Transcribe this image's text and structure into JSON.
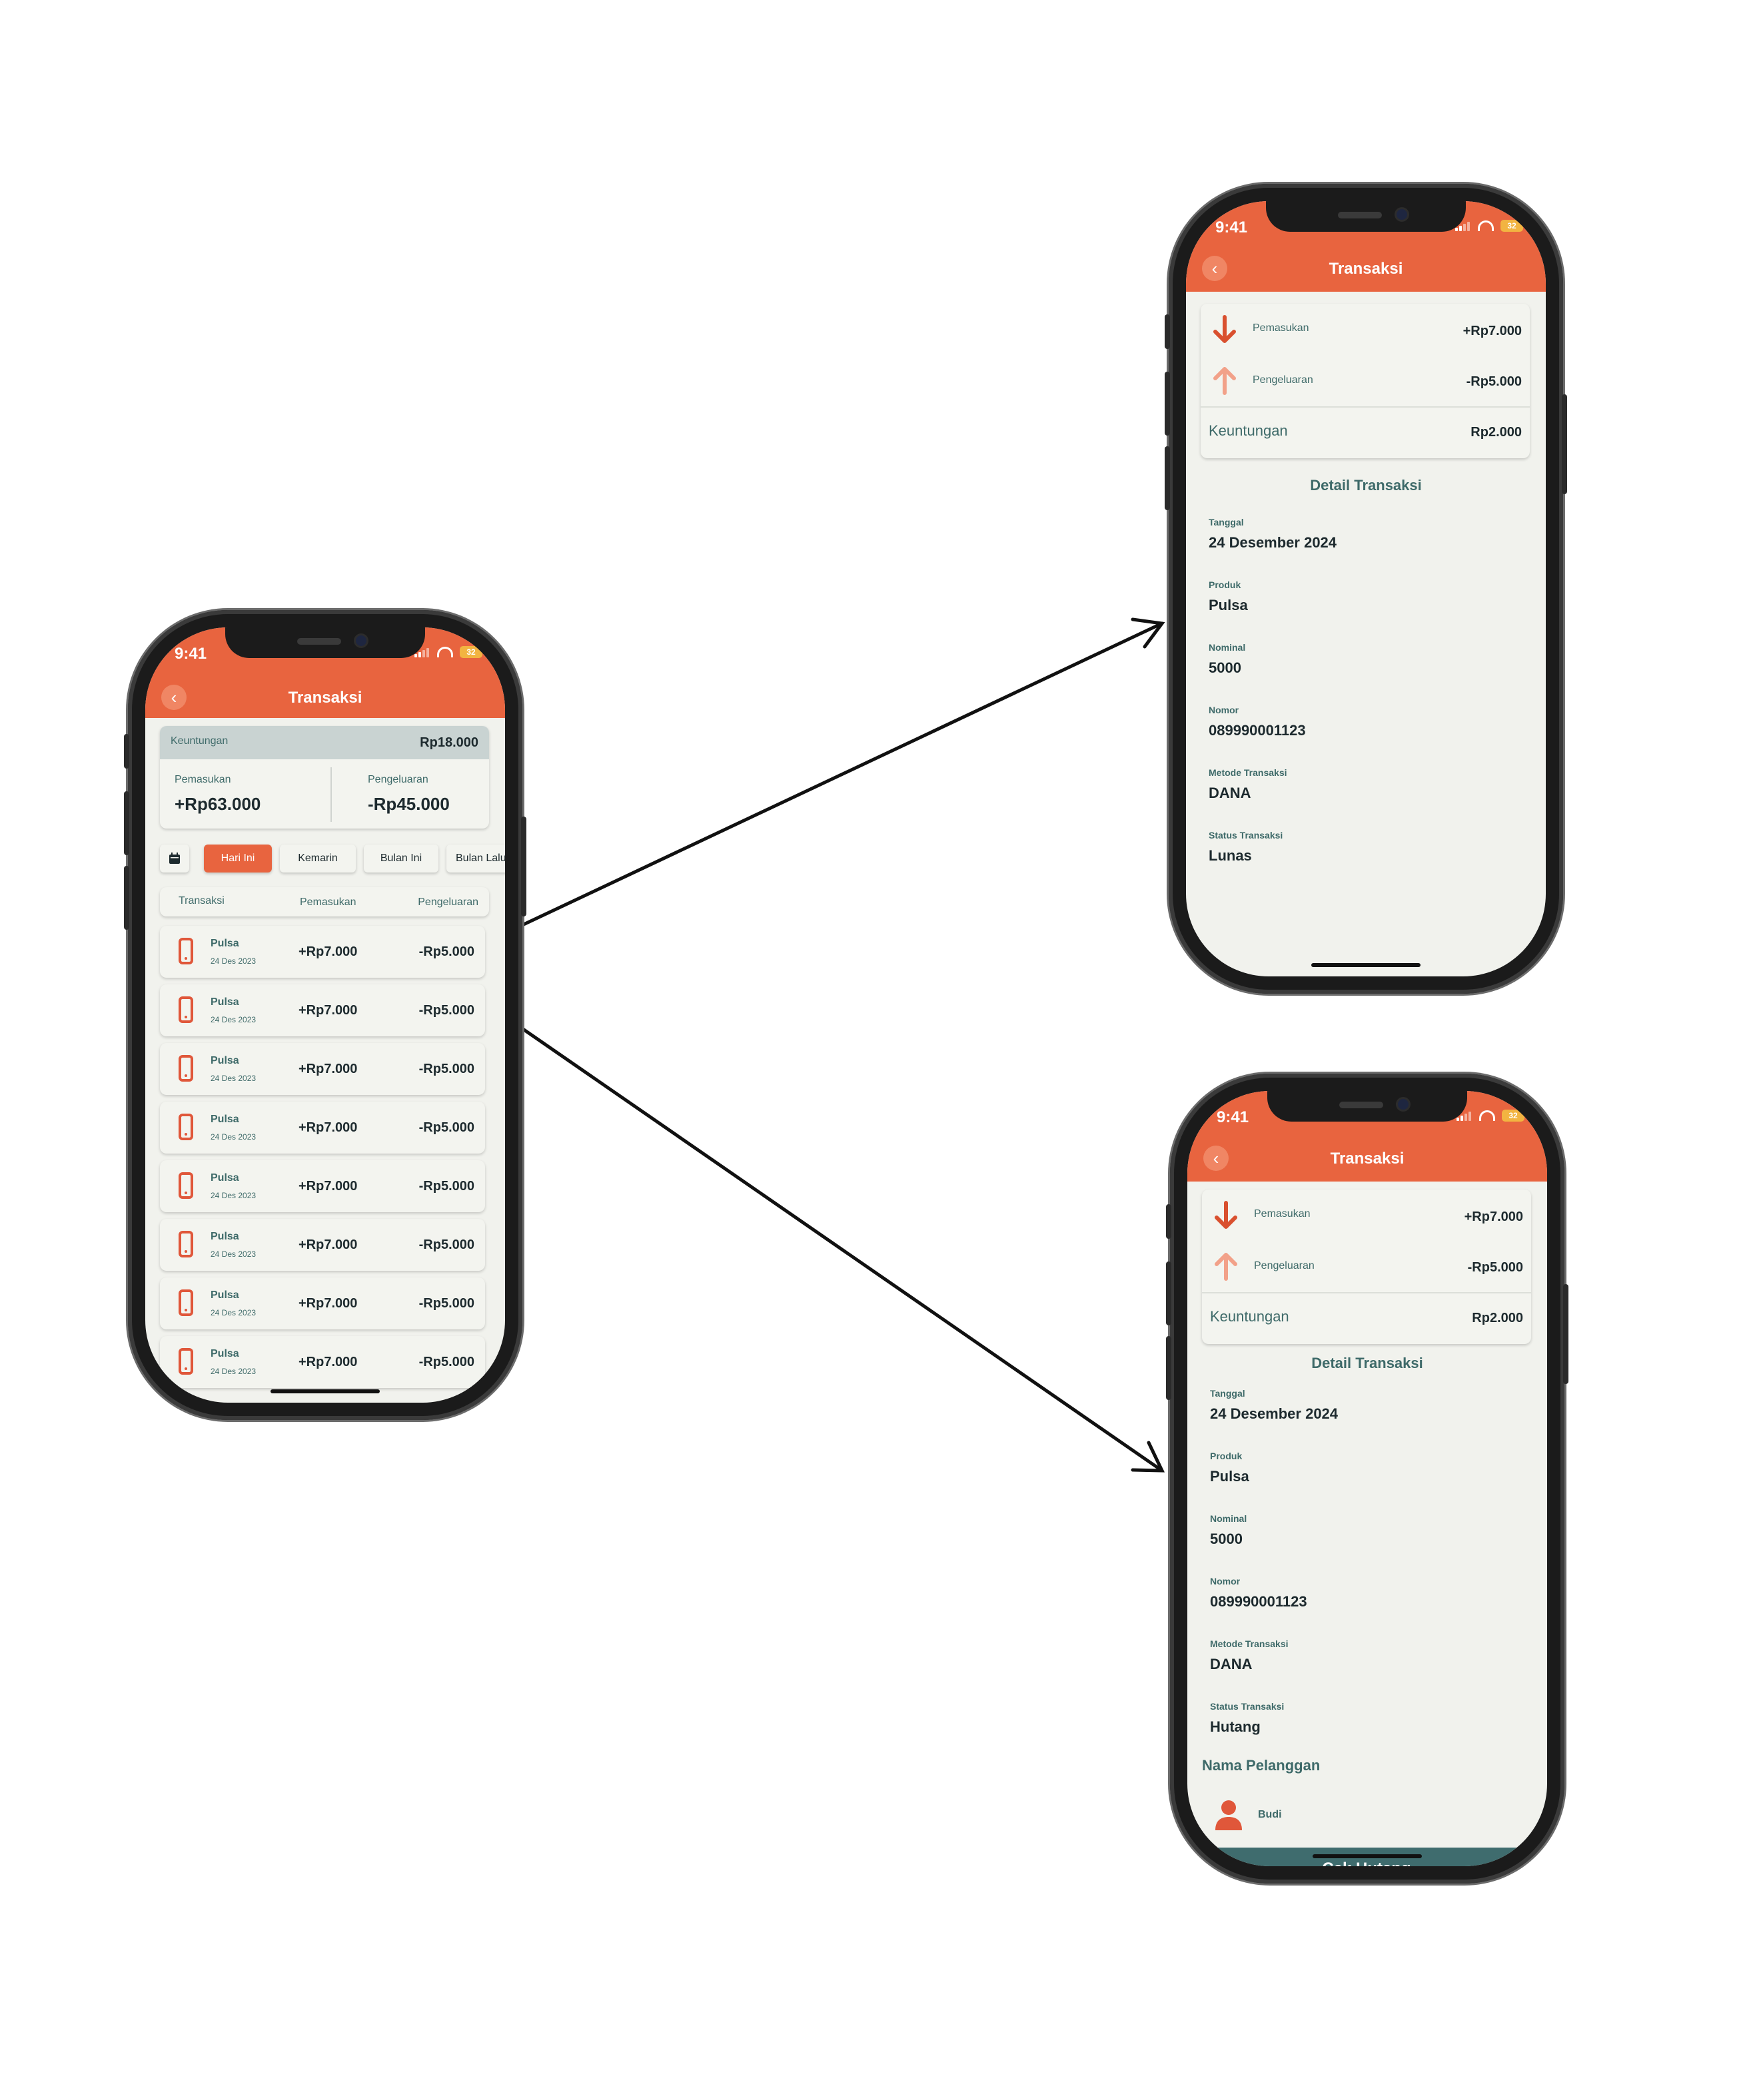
{
  "status": {
    "time": "9:41",
    "battery": "32"
  },
  "list_screen": {
    "title": "Transaksi",
    "summary": {
      "profit_label": "Keuntungan",
      "profit_value": "Rp18.000",
      "income_label": "Pemasukan",
      "income_value": "+Rp63.000",
      "expense_label": "Pengeluaran",
      "expense_value": "-Rp45.000"
    },
    "filters": [
      "Hari Ini",
      "Kemarin",
      "Bulan Ini",
      "Bulan Lalu"
    ],
    "active_filter": "Hari Ini",
    "columns": [
      "Transaksi",
      "Pemasukan",
      "Pengeluaran"
    ],
    "rows": [
      {
        "name": "Pulsa",
        "date": "24 Des 2023",
        "income": "+Rp7.000",
        "expense": "-Rp5.000"
      },
      {
        "name": "Pulsa",
        "date": "24 Des 2023",
        "income": "+Rp7.000",
        "expense": "-Rp5.000"
      },
      {
        "name": "Pulsa",
        "date": "24 Des 2023",
        "income": "+Rp7.000",
        "expense": "-Rp5.000"
      },
      {
        "name": "Pulsa",
        "date": "24 Des 2023",
        "income": "+Rp7.000",
        "expense": "-Rp5.000"
      },
      {
        "name": "Pulsa",
        "date": "24 Des 2023",
        "income": "+Rp7.000",
        "expense": "-Rp5.000"
      },
      {
        "name": "Pulsa",
        "date": "24 Des 2023",
        "income": "+Rp7.000",
        "expense": "-Rp5.000"
      },
      {
        "name": "Pulsa",
        "date": "24 Des 2023",
        "income": "+Rp7.000",
        "expense": "-Rp5.000"
      },
      {
        "name": "Pulsa",
        "date": "24 Des 2023",
        "income": "+Rp7.000",
        "expense": "-Rp5.000"
      }
    ]
  },
  "detail_lunas": {
    "title": "Transaksi",
    "income_label": "Pemasukan",
    "income_value": "+Rp7.000",
    "expense_label": "Pengeluaran",
    "expense_value": "-Rp5.000",
    "profit_label": "Keuntungan",
    "profit_value": "Rp2.000",
    "section_title": "Detail Transaksi",
    "fields": [
      {
        "label": "Tanggal",
        "value": "24 Desember 2024"
      },
      {
        "label": "Produk",
        "value": "Pulsa"
      },
      {
        "label": "Nominal",
        "value": "5000"
      },
      {
        "label": "Nomor",
        "value": "089990001123"
      },
      {
        "label": "Metode Transaksi",
        "value": "DANA"
      },
      {
        "label": "Status Transaksi",
        "value": "Lunas"
      }
    ]
  },
  "detail_hutang": {
    "title": "Transaksi",
    "income_label": "Pemasukan",
    "income_value": "+Rp7.000",
    "expense_label": "Pengeluaran",
    "expense_value": "-Rp5.000",
    "profit_label": "Keuntungan",
    "profit_value": "Rp2.000",
    "section_title": "Detail Transaksi",
    "fields": [
      {
        "label": "Tanggal",
        "value": "24 Desember 2024"
      },
      {
        "label": "Produk",
        "value": "Pulsa"
      },
      {
        "label": "Nominal",
        "value": "5000"
      },
      {
        "label": "Nomor",
        "value": "089990001123"
      },
      {
        "label": "Metode Transaksi",
        "value": "DANA"
      },
      {
        "label": "Status Transaksi",
        "value": "Hutang"
      }
    ],
    "customer_section": "Nama Pelanggan",
    "customer_name": "Budi",
    "button_label": "Cek Hutang"
  },
  "colors": {
    "accent": "#e8643f",
    "teal": "#3e6a69",
    "bg": "#f1f2ed",
    "button": "#3f6c6e"
  }
}
